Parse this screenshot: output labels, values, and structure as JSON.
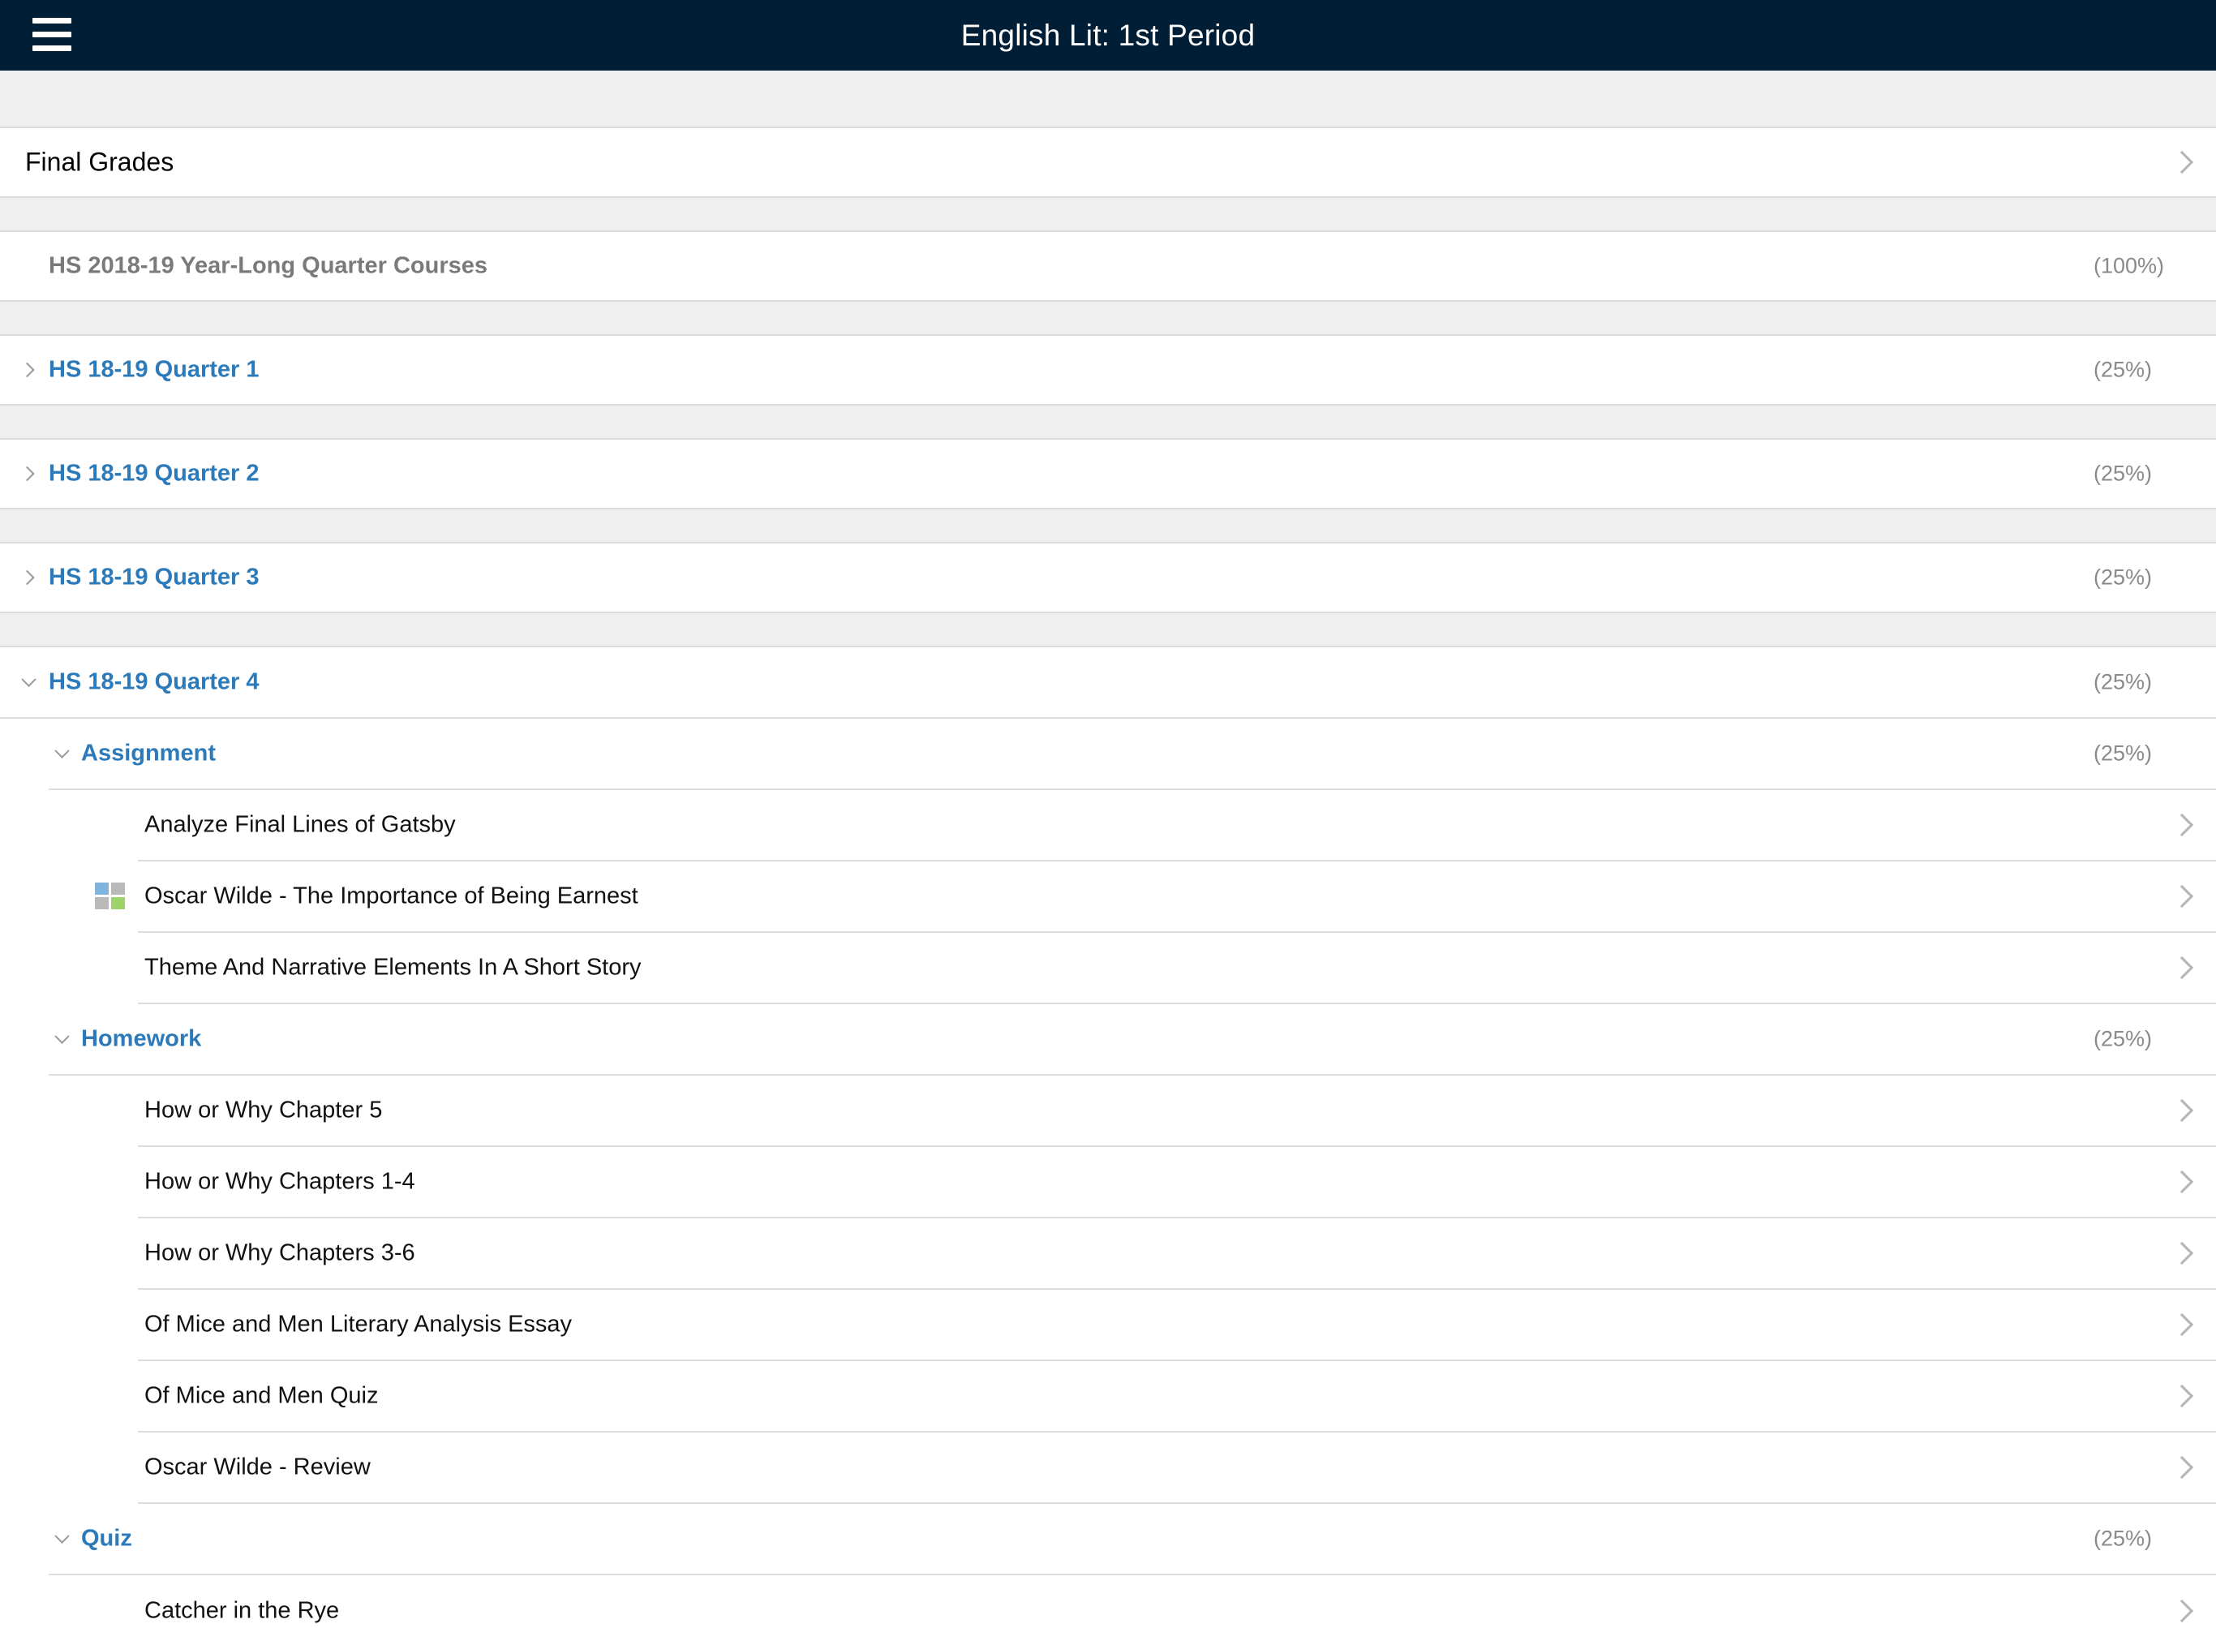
{
  "header": {
    "title": "English Lit: 1st Period",
    "menu_icon": "hamburger-icon"
  },
  "final_grades": {
    "label": "Final Grades"
  },
  "course": {
    "label": "HS 2018-19 Year-Long Quarter Courses",
    "weight": "(100%)"
  },
  "quarters": [
    {
      "label": "HS 18-19 Quarter 1",
      "weight": "(25%)",
      "expanded": false
    },
    {
      "label": "HS 18-19 Quarter 2",
      "weight": "(25%)",
      "expanded": false
    },
    {
      "label": "HS 18-19 Quarter 3",
      "weight": "(25%)",
      "expanded": false
    },
    {
      "label": "HS 18-19 Quarter 4",
      "weight": "(25%)",
      "expanded": true
    }
  ],
  "categories": [
    {
      "label": "Assignment",
      "weight": "(25%)",
      "items": [
        {
          "label": "Analyze Final Lines of Gatsby"
        },
        {
          "label": "Oscar Wilde - The Importance of Being Earnest",
          "icon": "grid-icon"
        },
        {
          "label": "Theme And Narrative Elements In A Short Story"
        }
      ]
    },
    {
      "label": "Homework",
      "weight": "(25%)",
      "items": [
        {
          "label": "How or Why Chapter 5"
        },
        {
          "label": "How or Why Chapters 1-4"
        },
        {
          "label": "How or Why Chapters 3-6"
        },
        {
          "label": "Of Mice and Men Literary Analysis Essay"
        },
        {
          "label": "Of Mice and Men Quiz"
        },
        {
          "label": "Oscar Wilde - Review"
        }
      ]
    },
    {
      "label": "Quiz",
      "weight": "(25%)",
      "items": [
        {
          "label": "Catcher in the Rye"
        }
      ]
    }
  ],
  "colors": {
    "header_bg": "#001f36",
    "link_blue": "#2c7ab9",
    "section_gray": "#efefef"
  }
}
